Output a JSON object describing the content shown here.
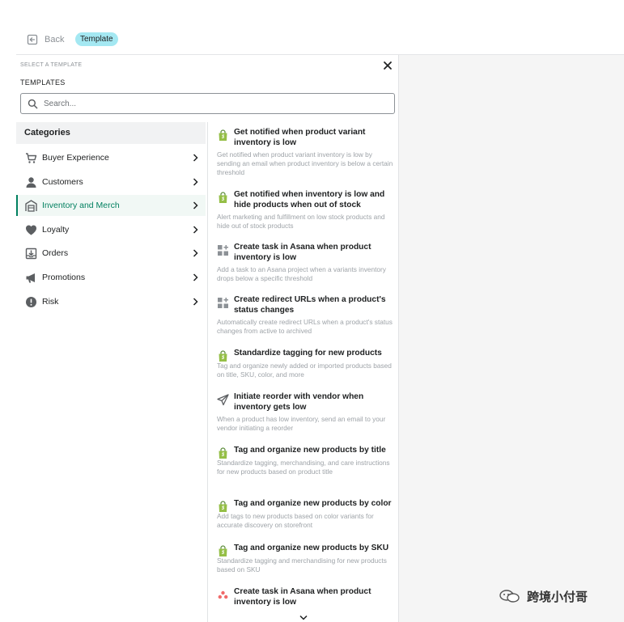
{
  "topbar": {
    "back_label": "Back",
    "badge_label": "Template"
  },
  "panel": {
    "eyebrow": "SELECT A TEMPLATE",
    "heading": "TEMPLATES",
    "search": {
      "placeholder": "Search...",
      "value": ""
    }
  },
  "categories": {
    "heading": "Categories",
    "active": "Inventory and Merch",
    "items": [
      {
        "label": "Buyer Experience",
        "icon": "cart-icon"
      },
      {
        "label": "Customers",
        "icon": "person-icon"
      },
      {
        "label": "Inventory and Merch",
        "icon": "warehouse-icon"
      },
      {
        "label": "Loyalty",
        "icon": "heart-icon"
      },
      {
        "label": "Orders",
        "icon": "inbox-download-icon"
      },
      {
        "label": "Promotions",
        "icon": "megaphone-icon"
      },
      {
        "label": "Risk",
        "icon": "alert-circle-icon"
      }
    ]
  },
  "templates": [
    {
      "icon": "shopify-bag-icon",
      "title": "Get notified when product variant inventory is low",
      "description": "Get notified when product variant inventory is low by sending an email when product inventory is below a certain threshold"
    },
    {
      "icon": "shopify-bag-icon",
      "title": "Get notified when inventory is low and hide products when out of stock",
      "description": "Alert marketing and fulfillment on low stock products and hide out of stock products"
    },
    {
      "icon": "apps-add-icon",
      "title": "Create task in Asana when product inventory is low",
      "description": "Add a task to an Asana project when a variants inventory drops below a specific threshold"
    },
    {
      "icon": "apps-add-icon",
      "title": "Create redirect URLs when a product's status changes",
      "description": "Automatically create redirect URLs when a product's status changes from active to archived"
    },
    {
      "icon": "shopify-bag-icon",
      "title": "Standardize tagging for new products",
      "description": "Tag and organize newly added or imported products based on title, SKU, color, and more"
    },
    {
      "icon": "paper-plane-icon",
      "title": "Initiate reorder with vendor when inventory gets low",
      "description": "When a product has low inventory, send an email to your vendor initiating a reorder"
    },
    {
      "icon": "shopify-bag-icon",
      "title": "Tag and organize new products by title",
      "description": "Standardize tagging, merchandising, and care instructions for new products based on product title"
    },
    {
      "icon": "shopify-bag-icon",
      "title": "Tag and organize new products by color",
      "description": "Add tags to new products based on color variants for accurate discovery on storefront"
    },
    {
      "icon": "shopify-bag-icon",
      "title": "Tag and organize new products by SKU",
      "description": "Standardize tagging and merchandising for new products based on SKU"
    },
    {
      "icon": "asana-logo-icon",
      "title": "Create task in Asana when product inventory is low",
      "description": ""
    }
  ],
  "watermark": {
    "text": "跨境小付哥"
  },
  "colors": {
    "accent": "#008060",
    "badge": "#a4e8f2",
    "shopify_green": "#95bf47"
  }
}
